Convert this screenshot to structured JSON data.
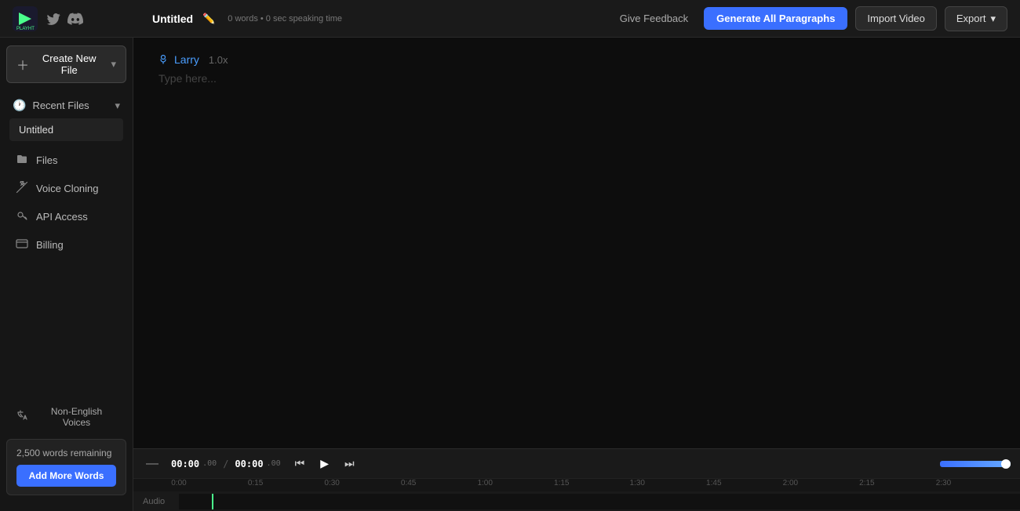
{
  "topbar": {
    "doc_title": "Untitled",
    "doc_meta": "0 words • 0 sec speaking time",
    "feedback_label": "Give Feedback",
    "generate_label": "Generate All Paragraphs",
    "import_label": "Import Video",
    "export_label": "Export"
  },
  "sidebar": {
    "create_label": "Create New File",
    "recent_files_label": "Recent Files",
    "recent_files": [
      {
        "name": "Untitled"
      }
    ],
    "nav_items": [
      {
        "label": "Files",
        "icon": "folder"
      },
      {
        "label": "Voice Cloning",
        "icon": "wand"
      },
      {
        "label": "API Access",
        "icon": "key"
      },
      {
        "label": "Billing",
        "icon": "card"
      }
    ],
    "non_english_label": "Non-English Voices",
    "words_remaining": "2,500 words remaining",
    "add_words_label": "Add More Words"
  },
  "editor": {
    "voice_name": "Larry",
    "voice_speed": "1.0x",
    "placeholder": "Type here..."
  },
  "timeline": {
    "mute": "—",
    "current_time_main": "00:00",
    "current_time_ms": ".00",
    "total_time_main": "00:00",
    "total_time_ms": ".00",
    "track_label": "Audio",
    "ruler_marks": [
      "0:00",
      "0:15",
      "0:30",
      "0:45",
      "1:00",
      "1:15",
      "1:30",
      "1:45",
      "2:00",
      "2:15",
      "2:30"
    ]
  }
}
